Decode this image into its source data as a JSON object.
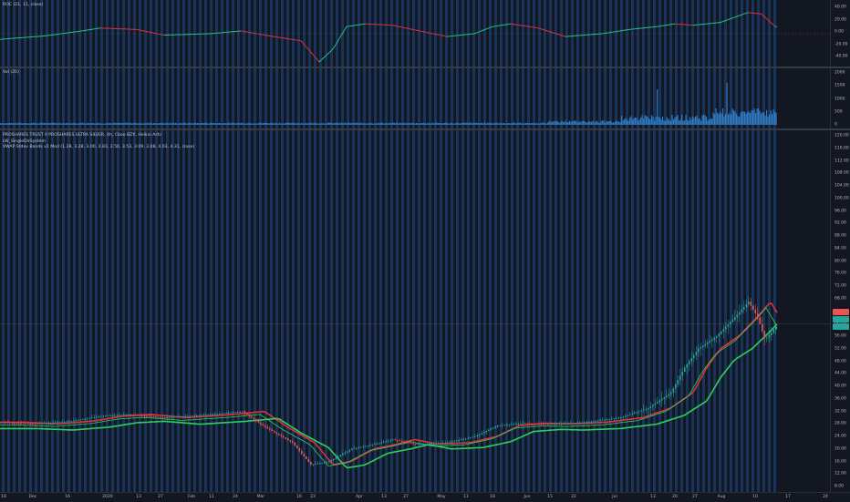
{
  "indicators": {
    "roc_label": "ROC (21, 11, close)",
    "vol_label": "Vol (20)"
  },
  "main_legend": {
    "line1": "PROSHARES TRUST II PROSHARES ULTRA SILVER, 4h, Cboe BZX, Heikin Ashi",
    "line2": "LW_SingleDirSystem",
    "line3": "VWAP Stdev Bands v2 Mod (1.28, 3.28, 3.00, 2.83, 2.50, 3.53, 3.09, 3.08, 4.03, 4.31, close)"
  },
  "roc_axis": [
    "40.00",
    "20.00",
    "0.00",
    "-20.00",
    "-40.00"
  ],
  "vol_axis": [
    "2000",
    "1500",
    "1000",
    "500",
    "0"
  ],
  "price_axis": [
    "120.00",
    "116.00",
    "112.00",
    "108.00",
    "104.00",
    "100.00",
    "96.00",
    "92.00",
    "88.00",
    "84.00",
    "80.00",
    "76.00",
    "72.00",
    "68.00",
    "64.00",
    "60.00",
    "56.00",
    "52.00",
    "48.00",
    "44.00",
    "40.00",
    "36.00",
    "32.00",
    "28.00",
    "24.00",
    "20.00",
    "16.00",
    "12.00",
    "8.00"
  ],
  "price_tags": {
    "last": "",
    "upper": "",
    "lower": ""
  },
  "x_axis": [
    "18",
    "Dec",
    "16",
    "2020",
    "13",
    "27",
    "Feb",
    "11",
    "24",
    "Mar",
    "16",
    "23",
    "Apr",
    "13",
    "27",
    "May",
    "11",
    "18",
    "Jun",
    "15",
    "22",
    "Jul",
    "13",
    "20",
    "27",
    "Aug",
    "10",
    "17",
    "24"
  ],
  "colors": {
    "background": "#131722",
    "stripe": "#1e4d8a",
    "roc_up": "#26c281",
    "roc_down": "#e0303a",
    "volume": "#2f7cc4",
    "candle_up": "#26a69a",
    "candle_down": "#ef5350",
    "ma_green": "#2ed158",
    "ma_red": "#e0303a",
    "price_tag": "#26a69a"
  },
  "chart_data": {
    "type": "candlestick",
    "title": "PROSHARES TRUST II PROSHARES ULTRA SILVER, 4h, Cboe BZX, Heikin Ashi",
    "ylim": [
      8,
      120
    ],
    "x": [
      "18",
      "Dec",
      "16",
      "2020",
      "13",
      "27",
      "Feb",
      "11",
      "24",
      "Mar",
      "16",
      "23",
      "Apr",
      "13",
      "27",
      "May",
      "11",
      "18",
      "Jun",
      "15",
      "22",
      "Jul",
      "13",
      "20",
      "27",
      "Aug",
      "10",
      "17",
      "24"
    ],
    "close_series": [
      {
        "t": "18",
        "v": 28.5
      },
      {
        "t": "Dec",
        "v": 28.0
      },
      {
        "t": "16",
        "v": 28.5
      },
      {
        "t": "2020",
        "v": 30.5
      },
      {
        "t": "13",
        "v": 31.0
      },
      {
        "t": "27",
        "v": 30.0
      },
      {
        "t": "Feb",
        "v": 30.5
      },
      {
        "t": "11",
        "v": 30.0
      },
      {
        "t": "24",
        "v": 32.0
      },
      {
        "t": "Mar",
        "v": 27.0
      },
      {
        "t": "16",
        "v": 15.0
      },
      {
        "t": "23",
        "v": 16.0
      },
      {
        "t": "Apr",
        "v": 20.5
      },
      {
        "t": "13",
        "v": 23.5
      },
      {
        "t": "27",
        "v": 21.5
      },
      {
        "t": "May",
        "v": 22.0
      },
      {
        "t": "11",
        "v": 22.5
      },
      {
        "t": "18",
        "v": 27.5
      },
      {
        "t": "Jun",
        "v": 28.0
      },
      {
        "t": "15",
        "v": 28.5
      },
      {
        "t": "22",
        "v": 28.0
      },
      {
        "t": "Jul",
        "v": 29.5
      },
      {
        "t": "13",
        "v": 31.5
      },
      {
        "t": "20",
        "v": 44.0
      },
      {
        "t": "27",
        "v": 55.0
      },
      {
        "t": "Aug",
        "v": 58.0
      },
      {
        "t": "10",
        "v": 67.0
      },
      {
        "t": "17",
        "v": 57.5
      }
    ],
    "roc_range": [
      -40,
      40
    ],
    "volume_range": [
      0,
      2000
    ]
  }
}
